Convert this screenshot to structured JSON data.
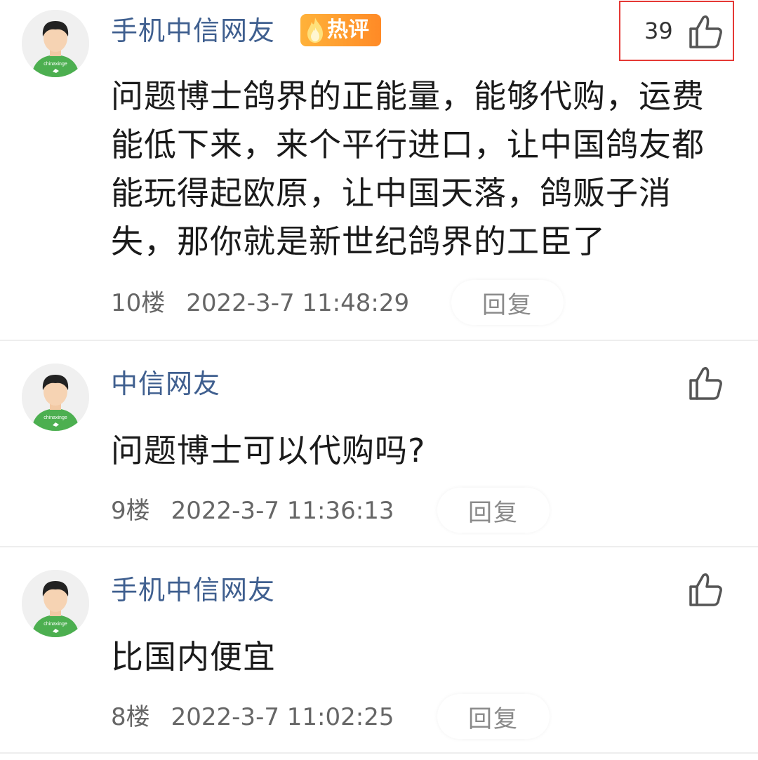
{
  "comments": [
    {
      "username": "手机中信网友",
      "hot_badge": "热评",
      "like_count": "39",
      "body": "问题博士鸽界的正能量，能够代购，运费能低下来，来个平行进口，让中国鸽友都能玩得起欧原，让中国天落，鸽贩子消失，那你就是新世纪鸽界的工臣了",
      "floor": "10楼",
      "timestamp": "2022-3-7 11:48:29",
      "reply_label": "回复",
      "avatar_text": "chinaxinge"
    },
    {
      "username": "中信网友",
      "body": "问题博士可以代购吗?",
      "floor": "9楼",
      "timestamp": "2022-3-7 11:36:13",
      "reply_label": "回复",
      "avatar_text": "chinaxinge"
    },
    {
      "username": "手机中信网友",
      "body": "比国内便宜",
      "floor": "8楼",
      "timestamp": "2022-3-7 11:02:25",
      "reply_label": "回复",
      "avatar_text": "chinaxinge"
    }
  ],
  "icons": {
    "like": "thumbs-up-icon",
    "hot": "flame-icon",
    "avatar": "avatar-cartoon"
  },
  "colors": {
    "username": "#3f5f8f",
    "badge_start": "#ffb23a",
    "badge_end": "#ff8a26",
    "highlight_border": "#e53935",
    "avatar_shirt": "#4caf50"
  }
}
